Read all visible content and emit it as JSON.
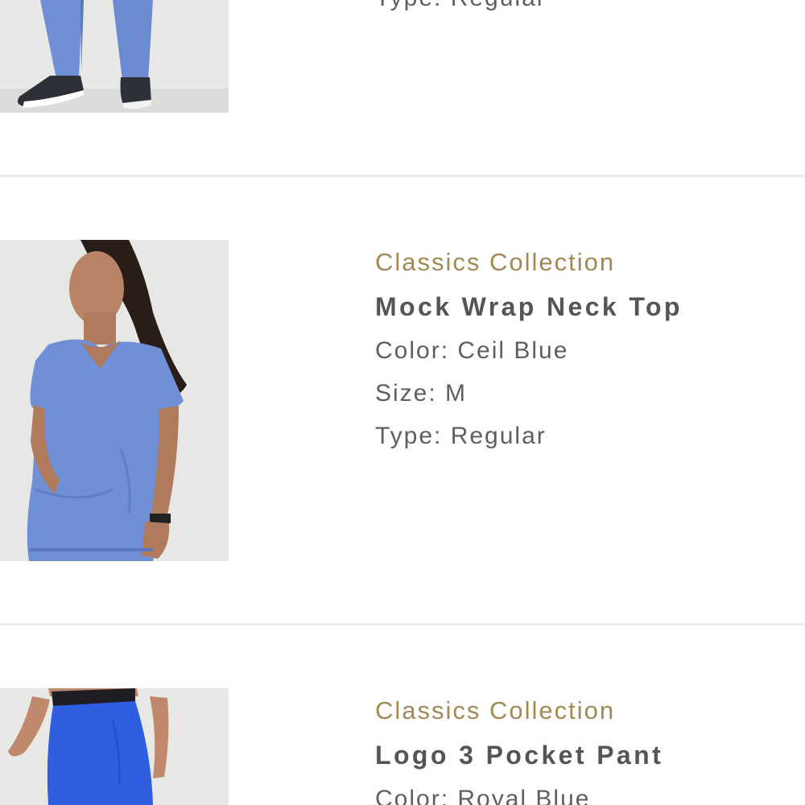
{
  "items": [
    {
      "type_line": "Type: Regular",
      "image": "pant-model-photo"
    },
    {
      "collection": "Classics Collection",
      "name": "Mock Wrap Neck Top",
      "color_line": "Color: Ceil Blue",
      "size_line": "Size: M",
      "type_line": "Type: Regular",
      "image": "top-model-photo"
    },
    {
      "collection": "Classics Collection",
      "name": "Logo 3 Pocket Pant",
      "color_line": "Color: Royal Blue",
      "image": "pant-model-photo"
    }
  ],
  "colors": {
    "collection_gold": "#a08a55",
    "title_gray": "#555555",
    "attr_gray": "#5f5f5f",
    "ceil_blue": "#6f8fd6",
    "royal_blue": "#2f5fe0",
    "divider": "#ececec"
  }
}
